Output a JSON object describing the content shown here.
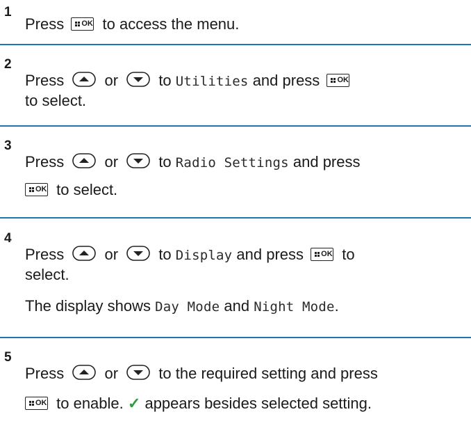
{
  "steps": [
    {
      "number": "1",
      "line1": {
        "a": "Press",
        "b": "to access the menu."
      }
    },
    {
      "number": "2",
      "line1": {
        "a": "Press",
        "or": "or",
        "to": "to",
        "menu": "Utilities",
        "and": "and press"
      },
      "line2": {
        "a": "to select."
      }
    },
    {
      "number": "3",
      "line1": {
        "a": "Press",
        "or": "or",
        "to": "to",
        "menu": "Radio Settings",
        "and": "and press"
      },
      "line2": {
        "a": "to select."
      }
    },
    {
      "number": "4",
      "line1": {
        "a": "Press",
        "or": "or",
        "to": "to",
        "menu": "Display",
        "and": "and press",
        "end": "to"
      },
      "line2": {
        "a": "select."
      },
      "line3": {
        "a": "The display shows",
        "opt1": "Day Mode",
        "and": "and",
        "opt2": "Night Mode",
        "end": "."
      }
    },
    {
      "number": "5",
      "line1": {
        "a": "Press",
        "or": "or",
        "b": "to the required setting and press"
      },
      "line2": {
        "a": "to enable.",
        "check": "✓",
        "b": "appears besides selected setting."
      }
    }
  ],
  "icons": {
    "menu_ok_key": "menu-ok-button-icon",
    "up_key": "up-arrow-button-icon",
    "down_key": "down-arrow-button-icon",
    "checkmark": "checkmark-icon"
  },
  "colors": {
    "divider": "#1d76b3",
    "check": "#2e9c3f"
  }
}
